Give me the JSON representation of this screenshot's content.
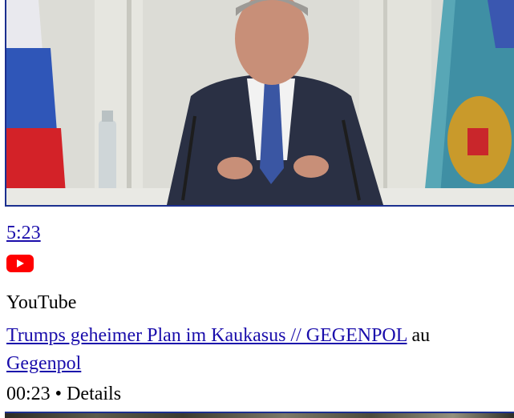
{
  "video": {
    "duration": "5:23",
    "source_icon": "youtube-icon",
    "source_name": "YouTube",
    "title": "Trumps geheimer Plan im Kaukasus // GEGENPOL",
    "title_suffix": "au",
    "channel": "Gegenpol",
    "timestamp": "00:23",
    "separator": "•",
    "details_label": "Details"
  },
  "colors": {
    "link": "#1a0dab",
    "youtube_red": "#ff0000",
    "thumbnail_border": "#1b2f8f"
  }
}
